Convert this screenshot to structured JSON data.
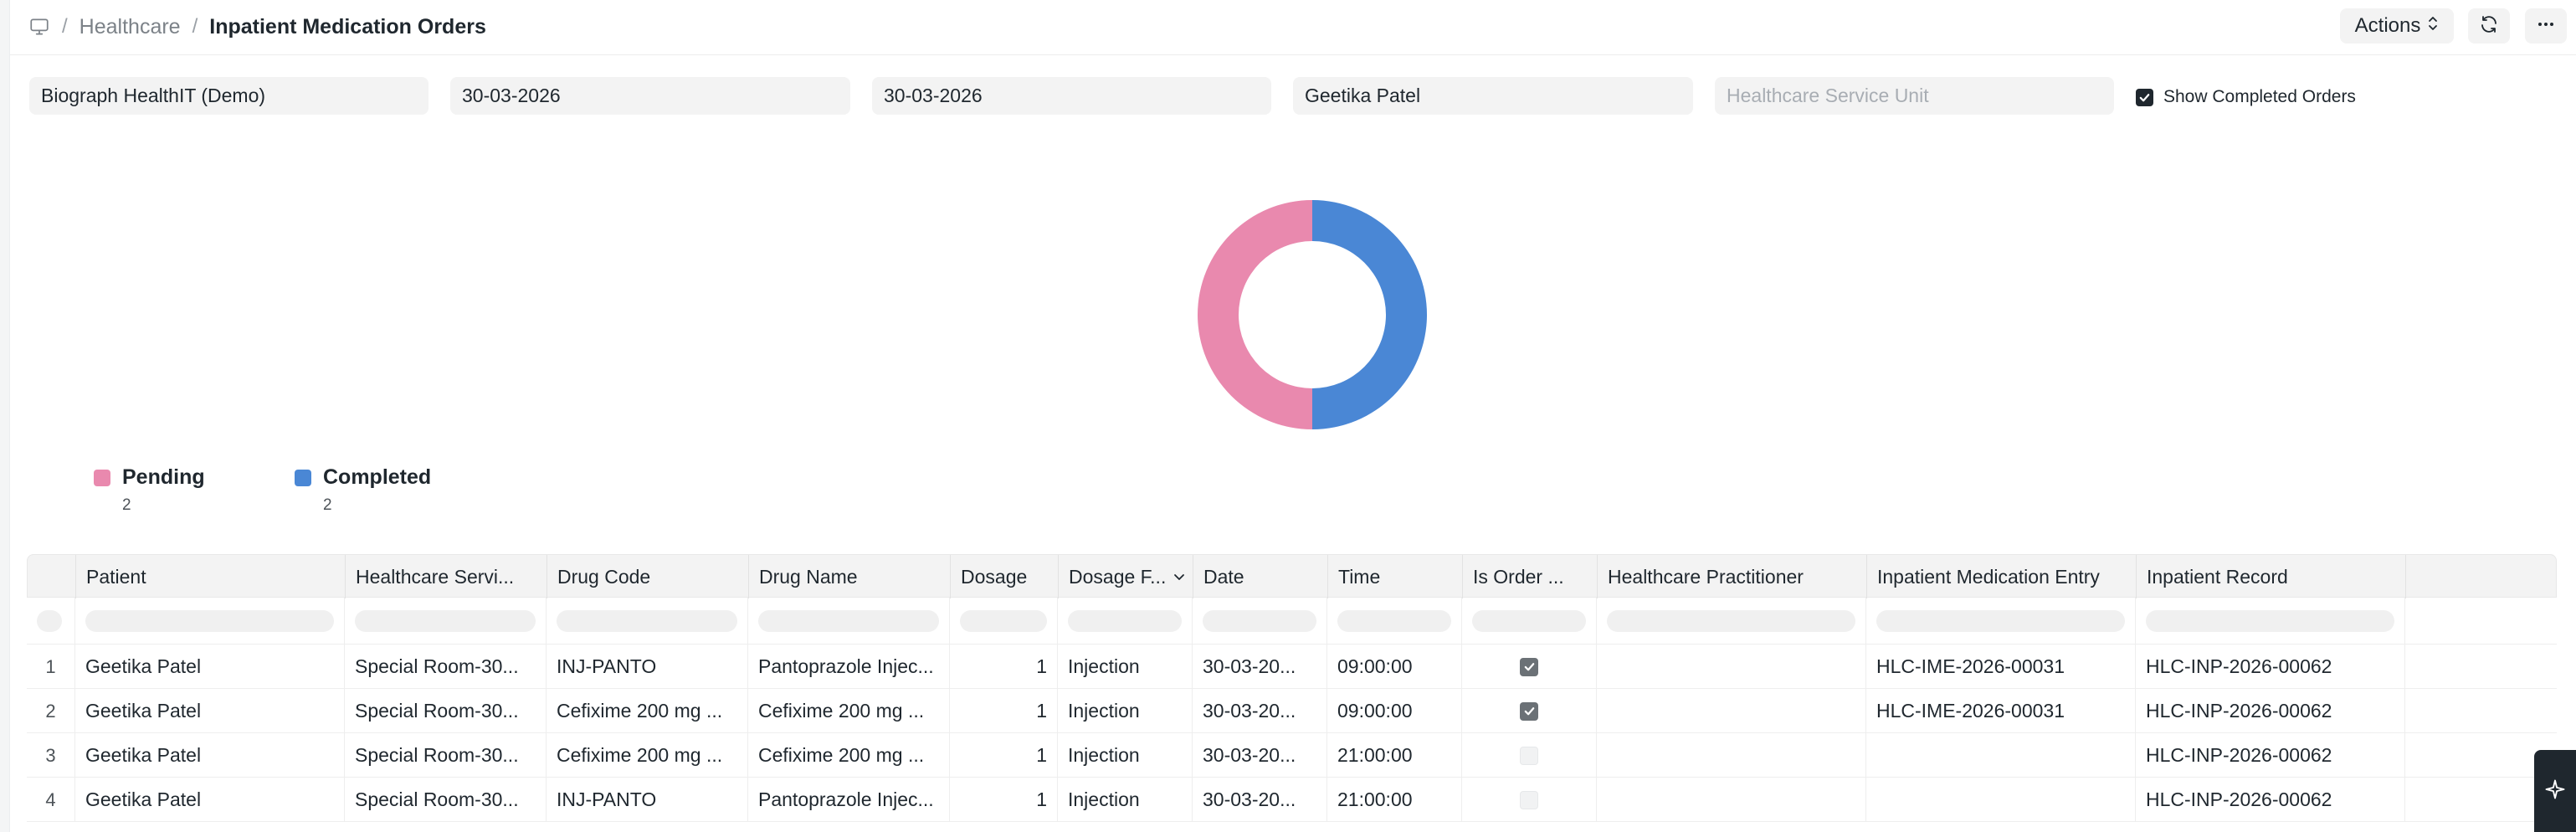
{
  "breadcrumb": {
    "items": [
      "Healthcare",
      "Inpatient Medication Orders"
    ]
  },
  "toolbar": {
    "actions_label": "Actions"
  },
  "filters": {
    "company": "Biograph HealthIT (Demo)",
    "from_date": "30-03-2026",
    "to_date": "30-03-2026",
    "patient": "Geetika Patel",
    "service_unit_placeholder": "Healthcare Service Unit",
    "show_completed_label": "Show Completed Orders",
    "show_completed_checked": true
  },
  "chart_data": {
    "type": "pie",
    "categories": [
      "Pending",
      "Completed"
    ],
    "values": [
      2,
      2
    ],
    "colors": [
      "#e989ae",
      "#4a87d5"
    ]
  },
  "legend": [
    {
      "label": "Pending",
      "value": "2",
      "color": "#e989ae"
    },
    {
      "label": "Completed",
      "value": "2",
      "color": "#4a87d5"
    }
  ],
  "table": {
    "columns": [
      "Patient",
      "Healthcare Servi...",
      "Drug Code",
      "Drug Name",
      "Dosage",
      "Dosage F...",
      "Date",
      "Time",
      "Is Order ...",
      "Healthcare Practitioner",
      "Inpatient Medication Entry",
      "Inpatient Record"
    ],
    "rows": [
      {
        "index": "1",
        "patient": "Geetika Patel",
        "service_unit": "Special Room-30...",
        "drug_code": "INJ-PANTO",
        "drug_name": "Pantoprazole Injec...",
        "dosage": "1",
        "dosage_form": "Injection",
        "date": "30-03-20...",
        "time": "09:00:00",
        "is_completed": true,
        "practitioner": "",
        "medication_entry": "HLC-IME-2026-00031",
        "inpatient_record": "HLC-INP-2026-00062"
      },
      {
        "index": "2",
        "patient": "Geetika Patel",
        "service_unit": "Special Room-30...",
        "drug_code": "Cefixime 200 mg ...",
        "drug_name": "Cefixime 200 mg ...",
        "dosage": "1",
        "dosage_form": "Injection",
        "date": "30-03-20...",
        "time": "09:00:00",
        "is_completed": true,
        "practitioner": "",
        "medication_entry": "HLC-IME-2026-00031",
        "inpatient_record": "HLC-INP-2026-00062"
      },
      {
        "index": "3",
        "patient": "Geetika Patel",
        "service_unit": "Special Room-30...",
        "drug_code": "Cefixime 200 mg ...",
        "drug_name": "Cefixime 200 mg ...",
        "dosage": "1",
        "dosage_form": "Injection",
        "date": "30-03-20...",
        "time": "21:00:00",
        "is_completed": false,
        "practitioner": "",
        "medication_entry": "",
        "inpatient_record": "HLC-INP-2026-00062"
      },
      {
        "index": "4",
        "patient": "Geetika Patel",
        "service_unit": "Special Room-30...",
        "drug_code": "INJ-PANTO",
        "drug_name": "Pantoprazole Injec...",
        "dosage": "1",
        "dosage_form": "Injection",
        "date": "30-03-20...",
        "time": "21:00:00",
        "is_completed": false,
        "practitioner": "",
        "medication_entry": "",
        "inpatient_record": "HLC-INP-2026-00062"
      }
    ]
  }
}
